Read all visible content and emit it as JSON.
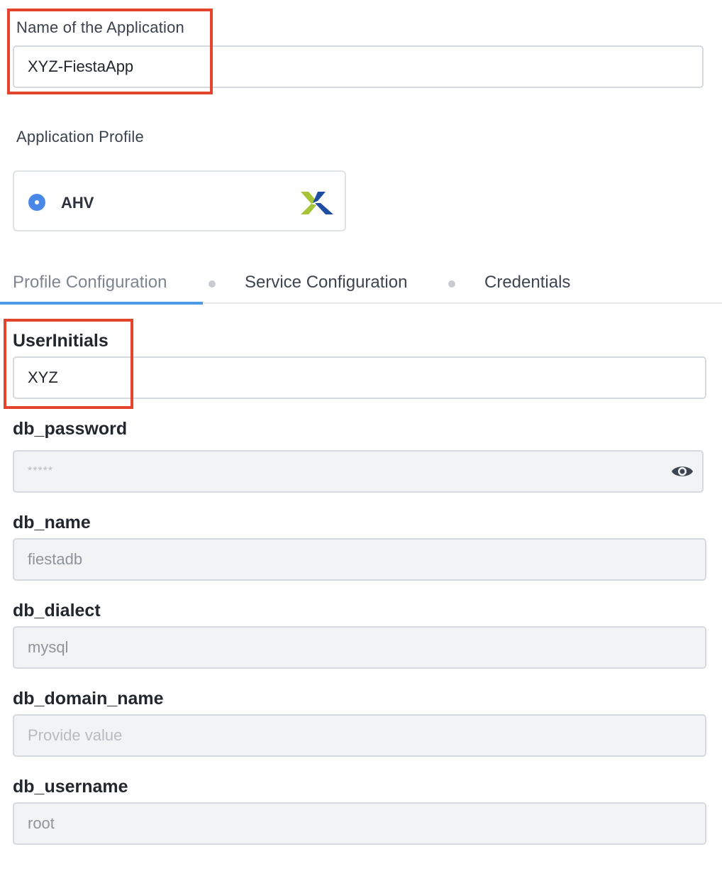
{
  "app_name": {
    "label": "Name of the Application",
    "value": "XYZ-FiestaApp"
  },
  "app_profile": {
    "label": "Application Profile",
    "option": "AHV",
    "logo_icon": "nutanix-x-logo"
  },
  "tabs": [
    {
      "label": "Profile Configuration",
      "active": true
    },
    {
      "label": "Service Configuration",
      "active": false
    },
    {
      "label": "Credentials",
      "active": false
    }
  ],
  "fields": {
    "user_initials": {
      "label": "UserInitials",
      "value": "XYZ"
    },
    "db_password": {
      "label": "db_password",
      "value": "*****",
      "icon": "eye-icon"
    },
    "db_name": {
      "label": "db_name",
      "value": "fiestadb"
    },
    "db_dialect": {
      "label": "db_dialect",
      "value": "mysql"
    },
    "db_domain_name": {
      "label": "db_domain_name",
      "placeholder": "Provide value"
    },
    "db_username": {
      "label": "db_username",
      "value": "root"
    }
  },
  "colors": {
    "highlight": "#e4432d",
    "accent": "#4a88e8",
    "tab_underline": "#4a9ae8",
    "logo_green": "#a6c437",
    "logo_blue": "#1f4da1"
  }
}
